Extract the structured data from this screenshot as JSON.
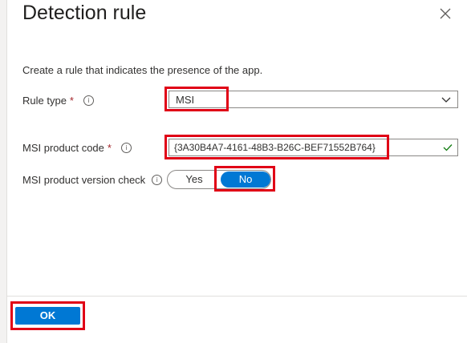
{
  "panel": {
    "title": "Detection rule",
    "description": "Create a rule that indicates the presence of the app."
  },
  "fields": {
    "rule_type": {
      "label": "Rule type",
      "required_mark": "*",
      "value": "MSI"
    },
    "msi_product_code": {
      "label": "MSI product code",
      "required_mark": "*",
      "value": "{3A30B4A7-4161-48B3-B26C-BEF71552B764}"
    },
    "msi_version_check": {
      "label": "MSI product version check",
      "options": [
        "Yes",
        "No"
      ],
      "selected": "No"
    }
  },
  "footer": {
    "ok_label": "OK"
  },
  "icons": {
    "info": "info-icon",
    "close": "close-icon",
    "chevron": "chevron-down-icon",
    "check": "checkmark-icon"
  },
  "colors": {
    "accent": "#0078d4",
    "highlight": "#e00016",
    "required": "#a4262c",
    "valid": "#107c10"
  }
}
